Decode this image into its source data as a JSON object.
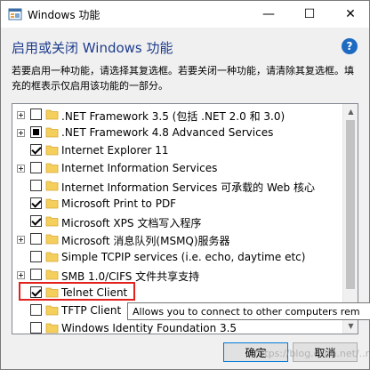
{
  "window": {
    "title": "Windows 功能",
    "minimize": "—",
    "maximize": "☐",
    "close": "✕"
  },
  "heading": "启用或关闭 Windows 功能",
  "help_label": "?",
  "description": "若要启用一种功能，请选择其复选框。若要关闭一种功能，请清除其复选框。填充的框表示仅启用该功能的一部分。",
  "features": [
    {
      "label": ".NET Framework 3.5 (包括 .NET 2.0 和 3.0)",
      "expandable": true,
      "state": "unchecked"
    },
    {
      "label": ".NET Framework 4.8 Advanced Services",
      "expandable": true,
      "state": "partial"
    },
    {
      "label": "Internet Explorer 11",
      "expandable": false,
      "state": "checked"
    },
    {
      "label": "Internet Information Services",
      "expandable": true,
      "state": "unchecked"
    },
    {
      "label": "Internet Information Services 可承载的 Web 核心",
      "expandable": false,
      "state": "unchecked"
    },
    {
      "label": "Microsoft Print to PDF",
      "expandable": false,
      "state": "checked"
    },
    {
      "label": "Microsoft XPS 文档写入程序",
      "expandable": false,
      "state": "checked"
    },
    {
      "label": "Microsoft 消息队列(MSMQ)服务器",
      "expandable": true,
      "state": "unchecked"
    },
    {
      "label": "Simple TCPIP services (i.e. echo, daytime etc)",
      "expandable": false,
      "state": "unchecked"
    },
    {
      "label": "SMB 1.0/CIFS 文件共享支持",
      "expandable": true,
      "state": "unchecked"
    },
    {
      "label": "Telnet Client",
      "expandable": false,
      "state": "checked"
    },
    {
      "label": "TFTP Client",
      "expandable": false,
      "state": "unchecked"
    },
    {
      "label": "Windows Identity Foundation 3.5",
      "expandable": false,
      "state": "unchecked"
    }
  ],
  "tooltip": "Allows you to connect to other computers rem",
  "buttons": {
    "ok": "确定",
    "cancel": "取消"
  },
  "watermark": "https://blog.csdn.net/..recz",
  "colors": {
    "heading": "#1e3c8c",
    "highlight": "#e3211c",
    "folder": "#f4cf5c"
  }
}
